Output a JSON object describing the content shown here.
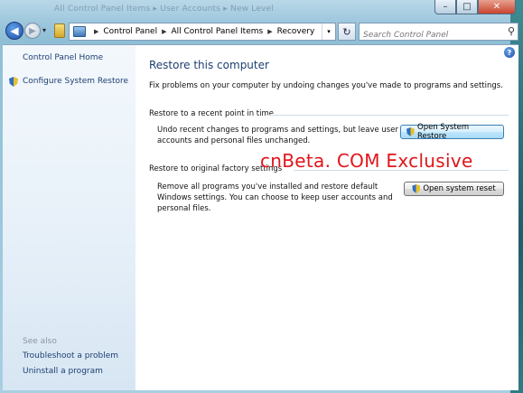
{
  "window": {
    "title_blur": "All Control Panel Items  ▸  User Accounts  ▸  New Level",
    "minimize": "–",
    "maximize": "□",
    "close": "✕"
  },
  "nav": {
    "back_glyph": "◀",
    "forward_glyph": "▶",
    "dropdown_glyph": "▾",
    "refresh_glyph": "↻",
    "breadcrumb": [
      "Control Panel",
      "All Control Panel Items",
      "Recovery"
    ],
    "breadcrumb_sep": "▶"
  },
  "search": {
    "placeholder": "Search Control Panel",
    "icon": "magnifier-icon"
  },
  "sidebar": {
    "items": [
      {
        "label": "Control Panel Home"
      },
      {
        "label": "Configure System Restore",
        "icon": "shield-icon"
      }
    ],
    "see_also_label": "See also",
    "see_also": [
      {
        "label": "Troubleshoot a problem"
      },
      {
        "label": "Uninstall a program"
      }
    ]
  },
  "main": {
    "help": "?",
    "title": "Restore this computer",
    "intro": "Fix problems on your computer by undoing changes you've made to programs and settings.",
    "sections": [
      {
        "heading": "Restore to a recent point in time",
        "text": "Undo recent changes to programs and settings, but leave user accounts and personal files unchanged.",
        "button": "Open System Restore"
      },
      {
        "heading": "Restore to original factory settings",
        "text": "Remove all programs you've installed and restore default Windows settings. You can choose to keep user accounts and personal files.",
        "button": "Open system reset"
      }
    ],
    "watermark": "cnBeta. COM Exclusive"
  },
  "colors": {
    "link": "#1e3f72",
    "watermark": "#e0151b"
  }
}
